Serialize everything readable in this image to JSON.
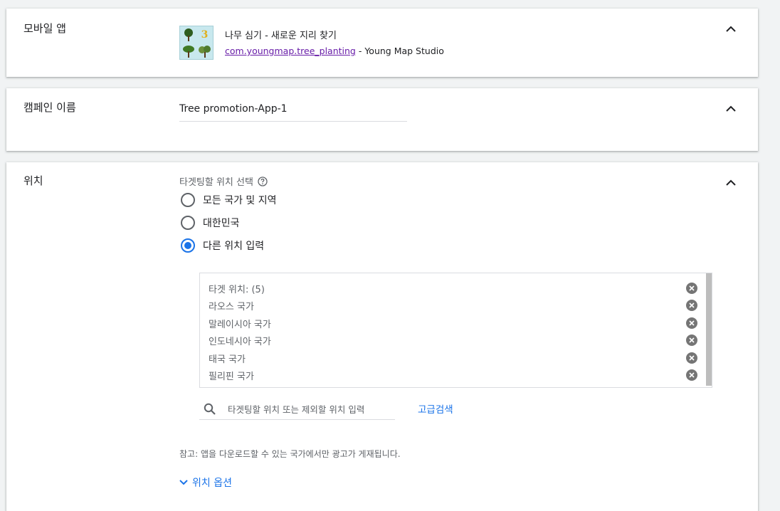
{
  "app_card": {
    "title": "모바일 앱",
    "icon_number": "3",
    "app_name": "나무 심기 - 새로운 지리 찾기",
    "package": "com.youngmap.tree_planting",
    "separator": " - ",
    "developer": "Young Map Studio"
  },
  "campaign_card": {
    "title": "캠페인 이름",
    "value": "Tree promotion-App-1"
  },
  "location_card": {
    "title": "위치",
    "heading": "타겟팅할 위치 선택",
    "options": [
      {
        "label": "모든 국가 및 지역",
        "checked": false
      },
      {
        "label": "대한민국",
        "checked": false
      },
      {
        "label": "다른 위치 입력",
        "checked": true
      }
    ],
    "targets_header": "타겟 위치: (5)",
    "targets": [
      "라오스 국가",
      "말레이시아 국가",
      "인도네시아 국가",
      "태국 국가",
      "필리핀 국가"
    ],
    "search_placeholder": "타겟팅할 위치 또는 제외할 위치 입력",
    "advanced_search": "고급검색",
    "note": "참고: 앱을 다운로드할 수 있는 국가에서만 광고가 게재됩니다.",
    "location_options": "위치 옵션"
  },
  "colors": {
    "accent": "#1a73e8",
    "link_visited": "#681da8",
    "background": "#f1f3f4"
  },
  "icons": [
    "chevron-up-icon",
    "help-icon",
    "clear-icon",
    "search-icon",
    "chevron-down-icon"
  ]
}
